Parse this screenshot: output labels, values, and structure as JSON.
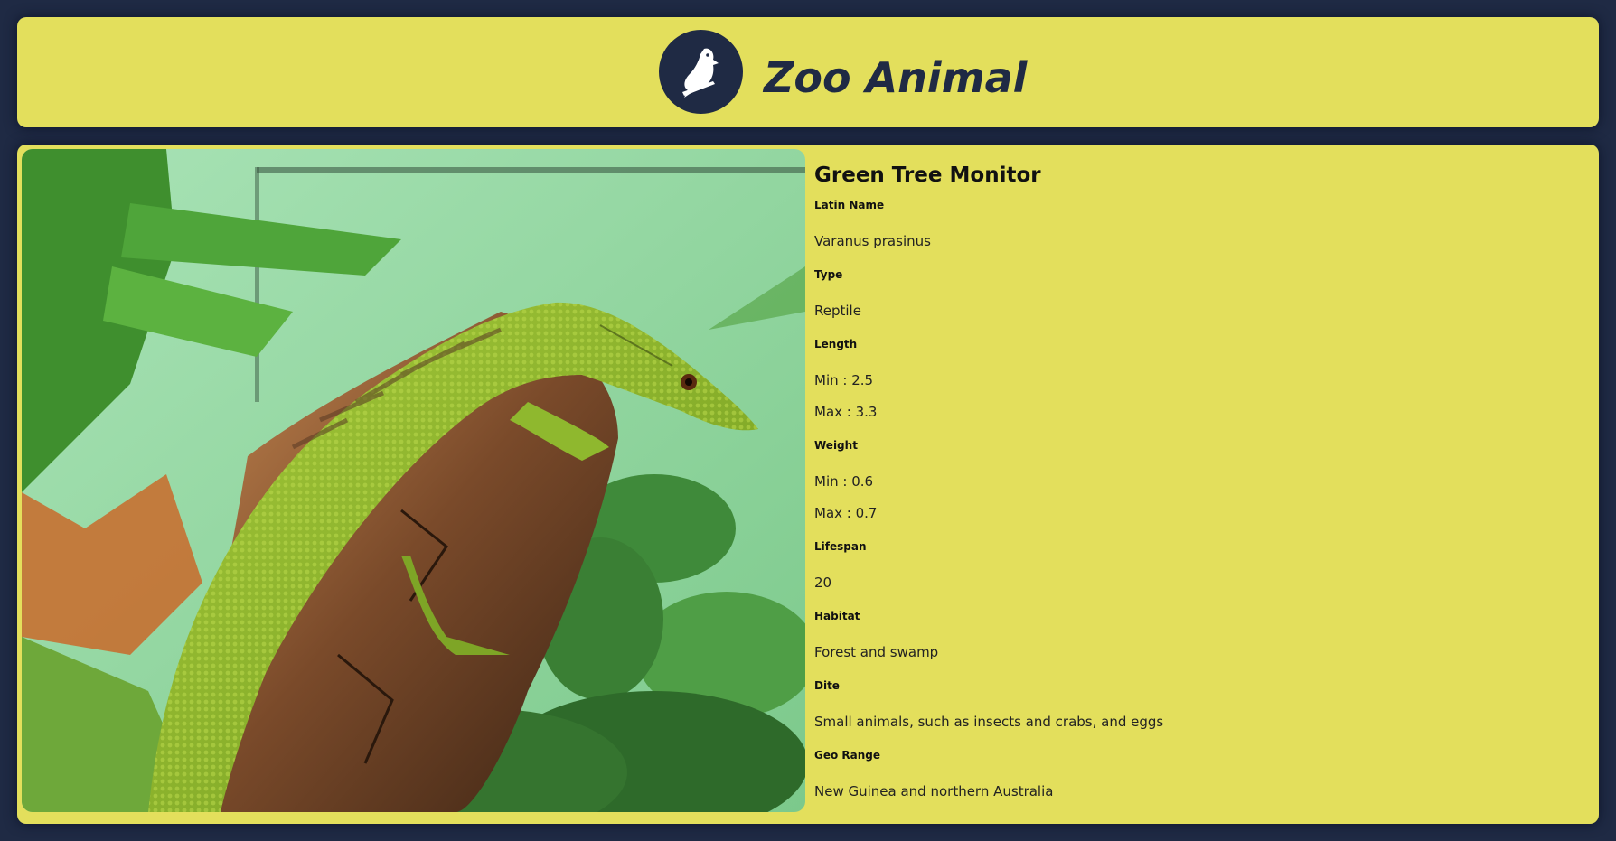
{
  "header": {
    "title": "Zoo Animal",
    "logo_icon": "bird-icon"
  },
  "colors": {
    "background": "#1f2a44",
    "panel": "#e3df5c",
    "text": "#111111"
  },
  "animal": {
    "name": "Green Tree Monitor",
    "photo_icon": "green-tree-monitor-photo",
    "latin_name_label": "Latin Name",
    "latin_name": "Varanus prasinus",
    "type_label": "Type",
    "type": "Reptile",
    "length_label": "Length",
    "length_min": "Min : 2.5",
    "length_max": "Max : 3.3",
    "weight_label": "Weight",
    "weight_min": "Min : 0.6",
    "weight_max": "Max : 0.7",
    "lifespan_label": "Lifespan",
    "lifespan": "20",
    "habitat_label": "Habitat",
    "habitat": "Forest and swamp",
    "diet_label": "Dite",
    "diet": "Small animals, such as insects and crabs, and eggs",
    "geo_range_label": "Geo Range",
    "geo_range": "New Guinea and northern Australia"
  }
}
